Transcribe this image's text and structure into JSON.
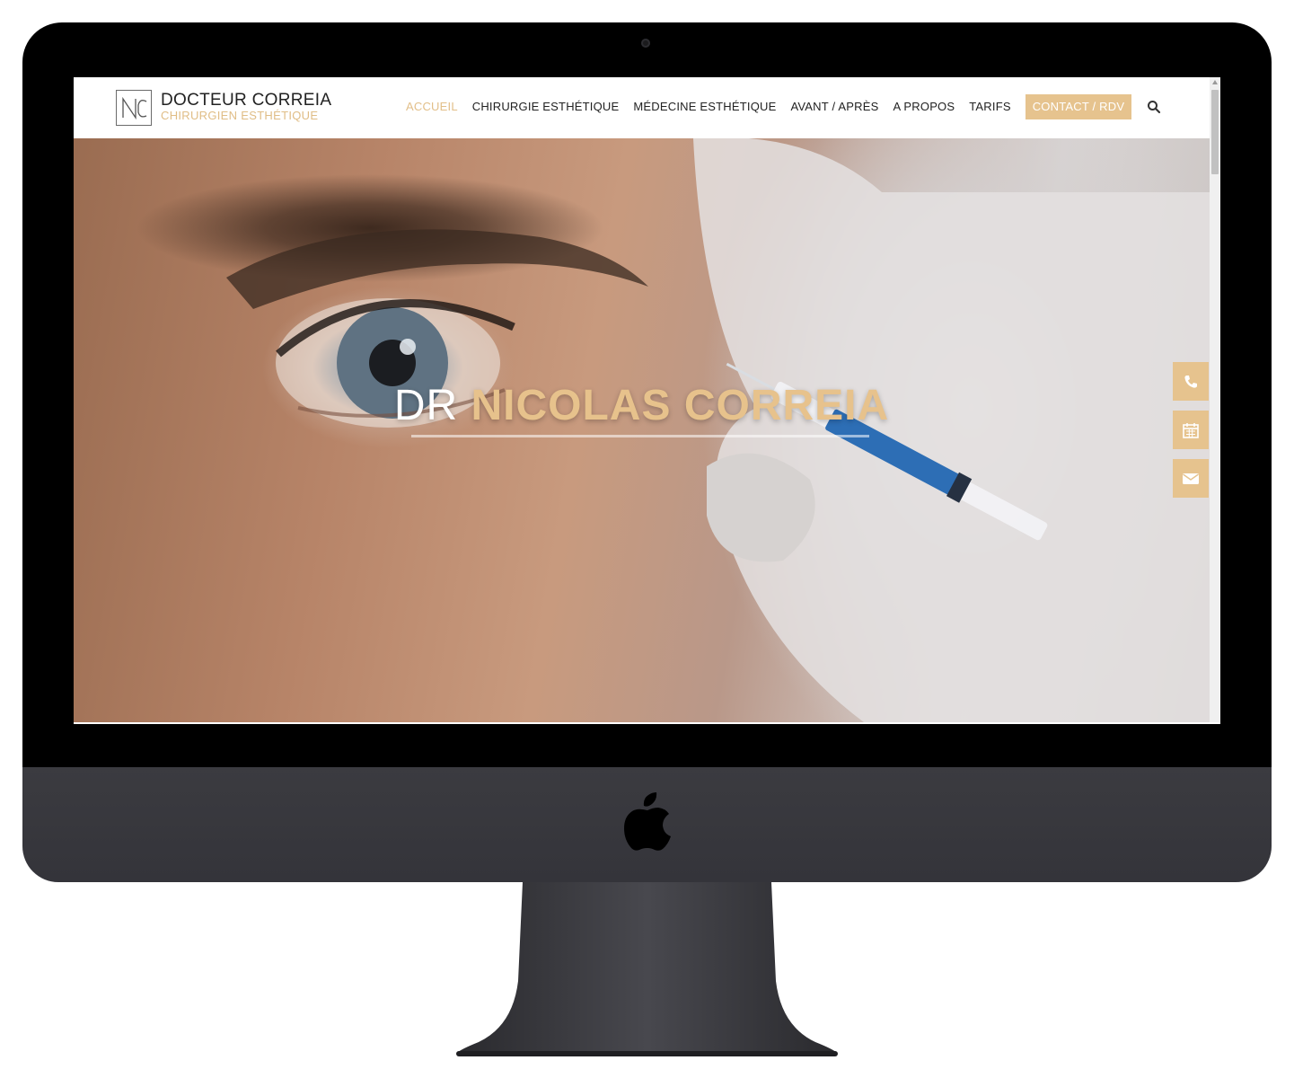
{
  "site": {
    "logo_title": "DOCTEUR CORREIA",
    "logo_subtitle": "CHIRURGIEN ESTHÉTIQUE"
  },
  "nav": {
    "items": [
      {
        "label": "ACCUEIL",
        "active": true
      },
      {
        "label": "CHIRURGIE ESTHÉTIQUE",
        "active": false
      },
      {
        "label": "MÉDECINE ESTHÉTIQUE",
        "active": false
      },
      {
        "label": "AVANT / APRÈS",
        "active": false
      },
      {
        "label": "A PROPOS",
        "active": false
      },
      {
        "label": "TARIFS",
        "active": false
      }
    ],
    "cta_label": "CONTACT / RDV",
    "search_icon": "search-icon"
  },
  "hero": {
    "title_prefix": "DR",
    "title_name": "NICOLAS CORREIA"
  },
  "side_actions": [
    {
      "icon": "phone-icon"
    },
    {
      "icon": "calendar-icon"
    },
    {
      "icon": "envelope-icon"
    }
  ],
  "colors": {
    "accent": "#e6c38e",
    "text": "#222222",
    "bezel": "#000000",
    "chin": "#38383d"
  }
}
